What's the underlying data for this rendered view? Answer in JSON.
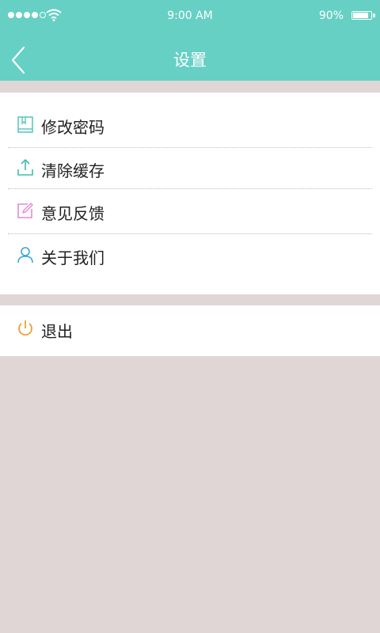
{
  "statusbar": {
    "time": "9:00 AM",
    "battery": "90%",
    "battery_level": 0.9
  },
  "header": {
    "title": "设置"
  },
  "menu": {
    "items": [
      {
        "label": "修改密码",
        "icon": "book-icon",
        "color": "#5cc8c0"
      },
      {
        "label": "清除缓存",
        "icon": "upload-icon",
        "color": "#3bbfae"
      },
      {
        "label": "意见反馈",
        "icon": "edit-icon",
        "color": "#e38ad8"
      },
      {
        "label": "关于我们",
        "icon": "user-icon",
        "color": "#3aa5d8"
      }
    ]
  },
  "logout": {
    "label": "退出",
    "icon": "power-icon",
    "color": "#f0a030"
  },
  "colors": {
    "header": "#66d0c4",
    "background": "#e0d6d6"
  }
}
